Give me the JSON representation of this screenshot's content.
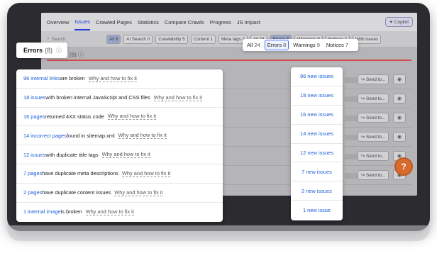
{
  "nav": {
    "items": [
      "Overview",
      "Issues",
      "Crawled Pages",
      "Statistics",
      "Compare Crawls",
      "Progress",
      "JS Impact"
    ],
    "active": "Issues",
    "copilot": "Copilot"
  },
  "filters": {
    "search_placeholder": "Search",
    "chips": [
      {
        "label": "All",
        "count": "8"
      },
      {
        "label": "AI Search",
        "count": "0"
      },
      {
        "label": "Crawlability",
        "count": "5"
      },
      {
        "label": "Content",
        "count": "1"
      },
      {
        "label": "Meta tags",
        "count": "2"
      },
      {
        "label": "All",
        "count": "24"
      },
      {
        "label": "Errors",
        "count": "8"
      },
      {
        "label": "Warnings",
        "count": "9"
      },
      {
        "label": "Notices",
        "count": "7"
      },
      {
        "label": "With issues",
        "count": ""
      }
    ]
  },
  "errors_header": {
    "title": "Errors",
    "count": "(8)",
    "info": "ⓘ"
  },
  "dim_header": "(8) ⓘ",
  "severity_tabs": [
    {
      "label": "All",
      "count": "24",
      "selected": false
    },
    {
      "label": "Errors",
      "count": "8",
      "selected": true
    },
    {
      "label": "Warnings",
      "count": "9",
      "selected": false
    },
    {
      "label": "Notices",
      "count": "7",
      "selected": false
    }
  ],
  "issues": [
    {
      "link": "96 internal links",
      "text": " are broken",
      "why": "Why and how to fix it",
      "new": "96 new issues"
    },
    {
      "link": "18 issues",
      "text": " with broken internal JavaScript and CSS files",
      "why": "Why and how to fix it",
      "new": "18 new issues"
    },
    {
      "link": "16 pages",
      "text": " returned 4XX status code",
      "why": "Why and how to fix it",
      "new": "16 new issues"
    },
    {
      "link": "14 incorrect pages",
      "text": " found in sitemap.xml",
      "why": "Why and how to fix it",
      "new": "14 new issues"
    },
    {
      "link": "12 issues",
      "text": " with duplicate title tags",
      "why": "Why and how to fix it",
      "new": "12 new issues"
    },
    {
      "link": "7 pages",
      "text": " have duplicate meta descriptions",
      "why": "Why and how to fix it",
      "new": "7 new issues"
    },
    {
      "link": "2 pages",
      "text": " have duplicate content issues",
      "why": "Why and how to fix it",
      "new": "2 new issues"
    },
    {
      "link": "1 internal image",
      "text": " is broken",
      "why": "Why and how to fix it",
      "new": "1 new issue"
    }
  ],
  "row_actions": {
    "send_label": "Send to...",
    "send_icon": "share-arrow-icon",
    "eye_icon": "eye-icon"
  },
  "help": "?",
  "colors": {
    "link": "#1a5fd6",
    "accent": "#1a3fd6",
    "error_line": "#d24a4a",
    "help": "#d86a2c"
  }
}
